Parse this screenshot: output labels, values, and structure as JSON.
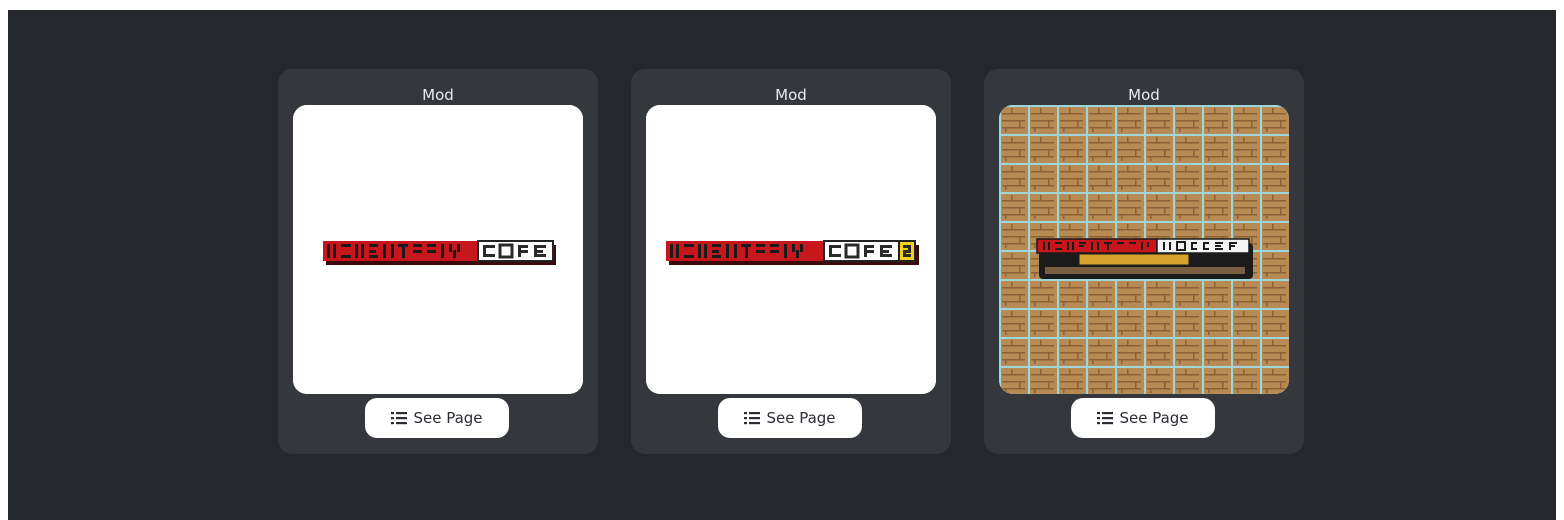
{
  "mods": [
    {
      "type_label": "Mod",
      "logo_icon": "momentariy-core-logo",
      "button_label": "See Page",
      "button_icon": "list-icon"
    },
    {
      "type_label": "Mod",
      "logo_icon": "momentariy-core2-logo",
      "button_label": "See Page",
      "button_icon": "list-icon"
    },
    {
      "type_label": "Mod",
      "logo_icon": "momentariy-modder-logo",
      "button_label": "See Page",
      "button_icon": "list-icon"
    }
  ],
  "colors": {
    "page_background": "#24272c",
    "card_background": "#34383d",
    "button_background": "#ffffff",
    "logo_red": "#c8161d",
    "logo_yellow": "#f2d21a"
  }
}
